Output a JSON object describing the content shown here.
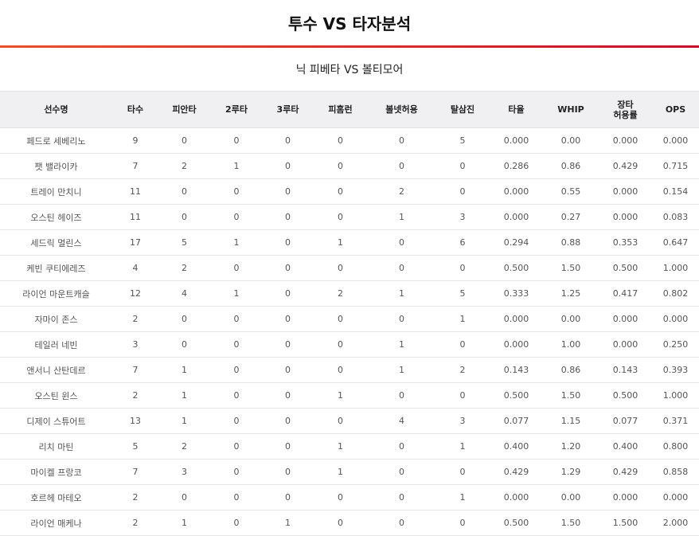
{
  "page": {
    "title": "투수 VS 타자분석",
    "matchup": "닉 피베타 VS 볼티모어"
  },
  "colors": {
    "accent_start": "#e8502d",
    "accent_end": "#c8102e",
    "header_bg": "#f0f0f2"
  },
  "table": {
    "headers": [
      "선수명",
      "타수",
      "피안타",
      "2루타",
      "3루타",
      "피홈런",
      "볼넷허용",
      "탈삼진",
      "타율",
      "WHIP",
      "장타|허용률",
      "OPS"
    ],
    "rows": [
      [
        "페드로 세베리노",
        "9",
        "0",
        "0",
        "0",
        "0",
        "0",
        "5",
        "0.000",
        "0.00",
        "0.000",
        "0.000"
      ],
      [
        "팻 밸라이카",
        "7",
        "2",
        "1",
        "0",
        "0",
        "0",
        "0",
        "0.286",
        "0.86",
        "0.429",
        "0.715"
      ],
      [
        "트레이 만치니",
        "11",
        "0",
        "0",
        "0",
        "0",
        "2",
        "0",
        "0.000",
        "0.55",
        "0.000",
        "0.154"
      ],
      [
        "오스틴 헤이즈",
        "11",
        "0",
        "0",
        "0",
        "0",
        "1",
        "3",
        "0.000",
        "0.27",
        "0.000",
        "0.083"
      ],
      [
        "세드릭 멀린스",
        "17",
        "5",
        "1",
        "0",
        "1",
        "0",
        "6",
        "0.294",
        "0.88",
        "0.353",
        "0.647"
      ],
      [
        "케빈 쿠티에레즈",
        "4",
        "2",
        "0",
        "0",
        "0",
        "0",
        "0",
        "0.500",
        "1.50",
        "0.500",
        "1.000"
      ],
      [
        "라이언 마운트캐슬",
        "12",
        "4",
        "1",
        "0",
        "2",
        "1",
        "5",
        "0.333",
        "1.25",
        "0.417",
        "0.802"
      ],
      [
        "자마이 존스",
        "2",
        "0",
        "0",
        "0",
        "0",
        "0",
        "1",
        "0.000",
        "0.00",
        "0.000",
        "0.000"
      ],
      [
        "테일러 네빈",
        "3",
        "0",
        "0",
        "0",
        "0",
        "1",
        "0",
        "0.000",
        "1.00",
        "0.000",
        "0.250"
      ],
      [
        "앤서니 산탄데르",
        "7",
        "1",
        "0",
        "0",
        "0",
        "1",
        "2",
        "0.143",
        "0.86",
        "0.143",
        "0.393"
      ],
      [
        "오스틴 윈스",
        "2",
        "1",
        "0",
        "0",
        "1",
        "0",
        "0",
        "0.500",
        "1.50",
        "0.500",
        "1.000"
      ],
      [
        "디제이 스튜어트",
        "13",
        "1",
        "0",
        "0",
        "0",
        "4",
        "3",
        "0.077",
        "1.15",
        "0.077",
        "0.371"
      ],
      [
        "리치 마틴",
        "5",
        "2",
        "0",
        "0",
        "1",
        "0",
        "1",
        "0.400",
        "1.20",
        "0.400",
        "0.800"
      ],
      [
        "마이켈 프랑코",
        "7",
        "3",
        "0",
        "0",
        "1",
        "0",
        "0",
        "0.429",
        "1.29",
        "0.429",
        "0.858"
      ],
      [
        "호르헤 마테오",
        "2",
        "0",
        "0",
        "0",
        "0",
        "0",
        "1",
        "0.000",
        "0.00",
        "0.000",
        "0.000"
      ],
      [
        "라이언 매케나",
        "2",
        "1",
        "0",
        "1",
        "0",
        "0",
        "0",
        "0.500",
        "1.50",
        "1.500",
        "2.000"
      ]
    ]
  }
}
